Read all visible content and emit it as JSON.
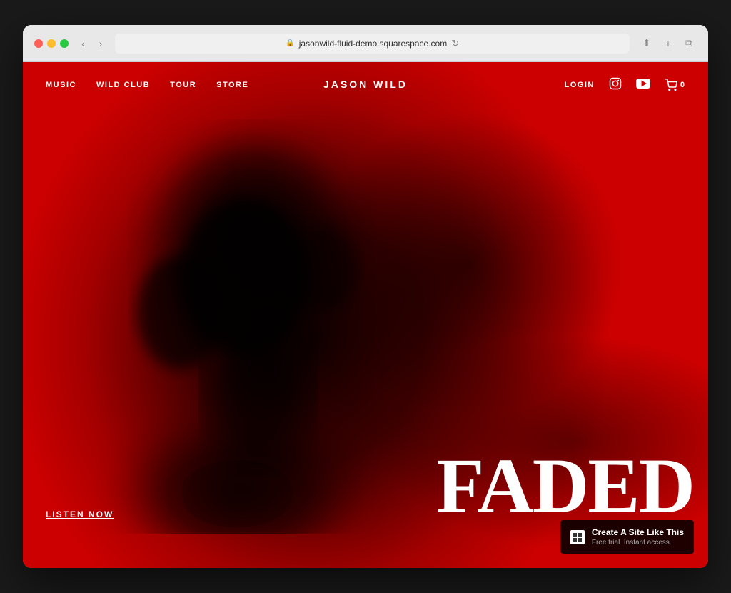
{
  "browser": {
    "url": "jasonwild-fluid-demo.squarespace.com",
    "controls": {
      "back": "‹",
      "forward": "›"
    }
  },
  "nav": {
    "left_items": [
      {
        "label": "MUSIC",
        "id": "music"
      },
      {
        "label": "WILD CLUB",
        "id": "wild-club"
      },
      {
        "label": "TOUR",
        "id": "tour"
      },
      {
        "label": "STORE",
        "id": "store"
      }
    ],
    "site_title": "JASON WILD",
    "login_label": "LOGIN",
    "cart_count": "0"
  },
  "hero": {
    "title": "FADED",
    "cta_label": "LISTEN NOW"
  },
  "squarespace_badge": {
    "logo": "⊞",
    "title": "Create A Site Like This",
    "subtitle": "Free trial. Instant access."
  },
  "colors": {
    "hero_bg": "#cc0000",
    "nav_text": "#ffffff",
    "hero_title": "#ffffff"
  }
}
